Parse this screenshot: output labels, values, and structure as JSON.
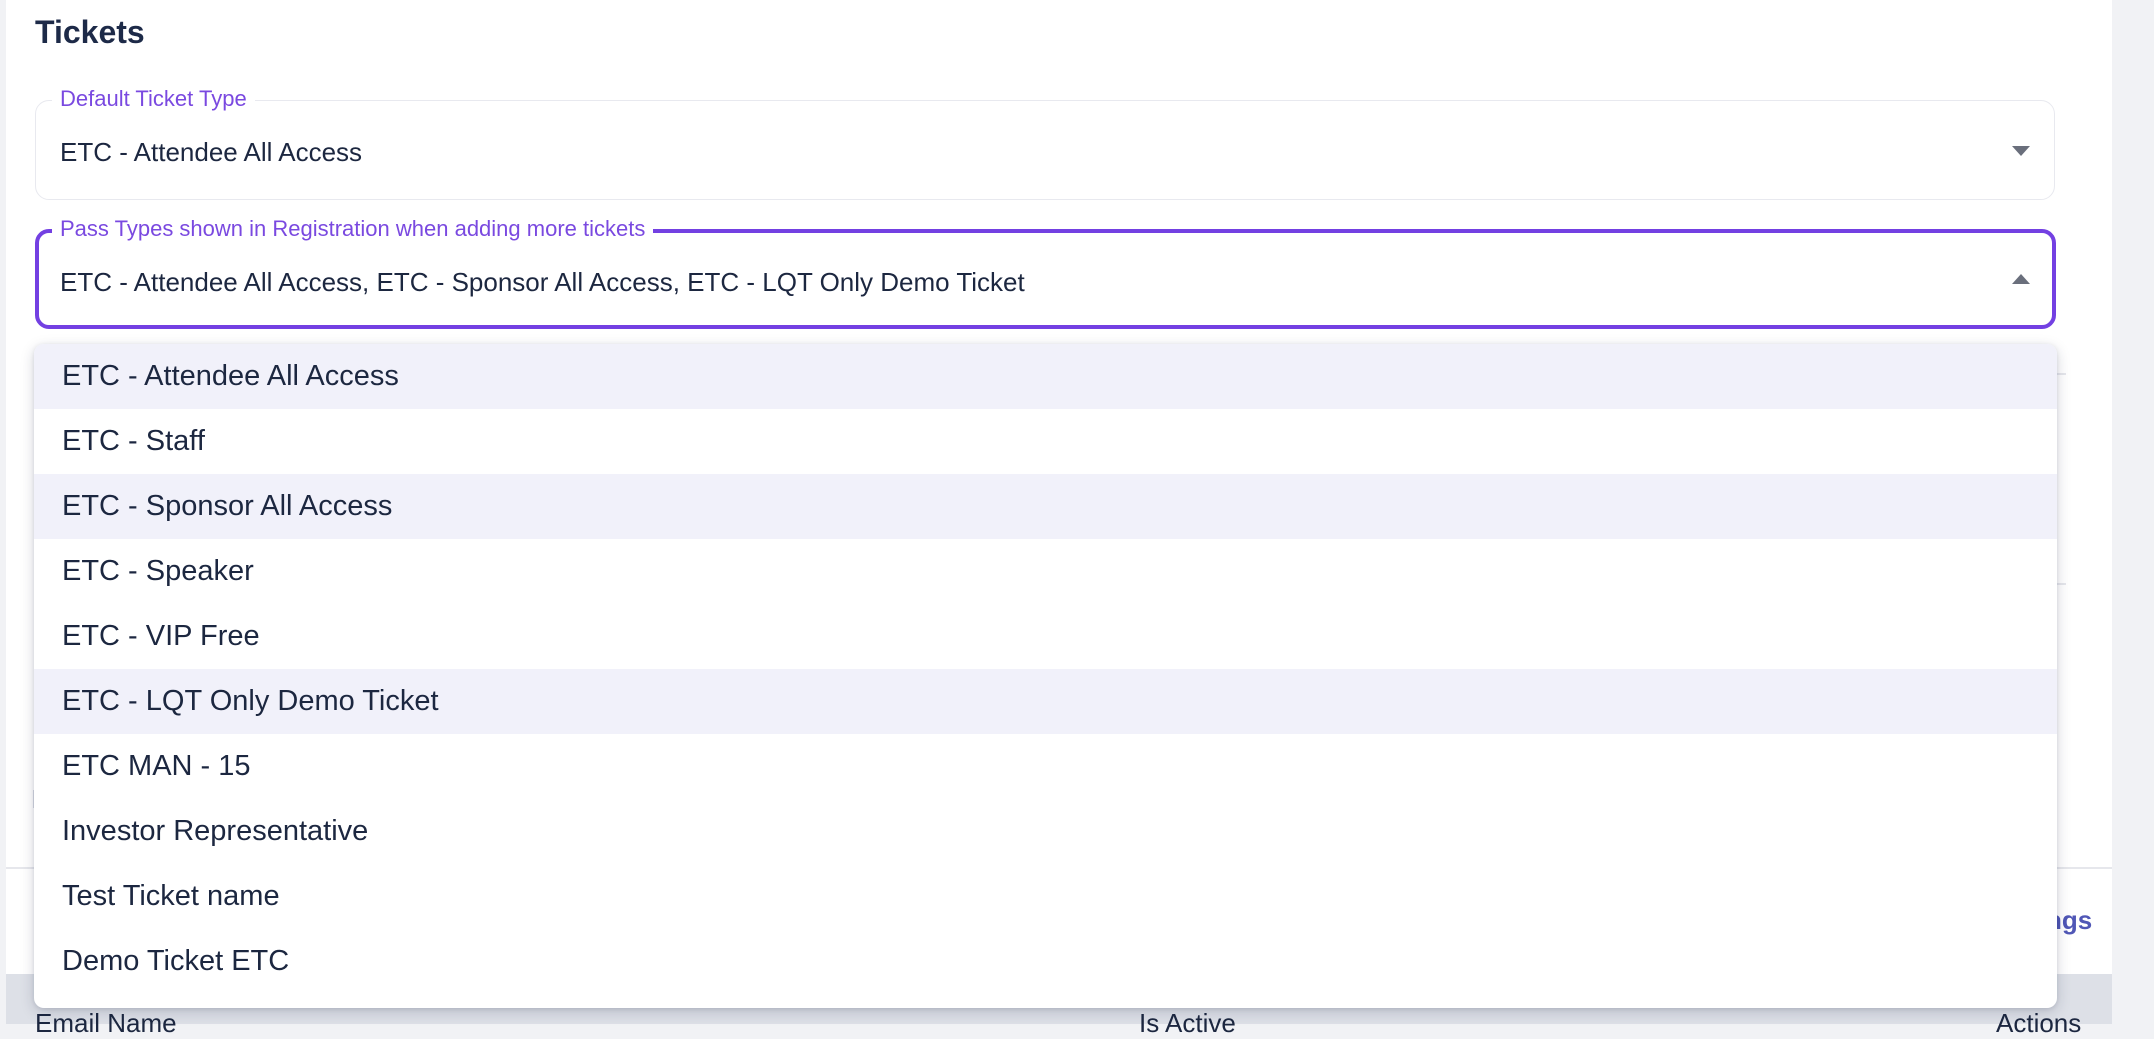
{
  "section": {
    "title": "Tickets"
  },
  "default_ticket_type": {
    "label": "Default Ticket Type",
    "value": "ETC - Attendee All Access"
  },
  "pass_types": {
    "label": "Pass Types shown in Registration when adding more tickets",
    "value": "ETC - Attendee All Access, ETC - Sponsor All Access, ETC - LQT Only Demo Ticket",
    "options": [
      {
        "label": "ETC - Attendee All Access",
        "selected": true
      },
      {
        "label": "ETC - Staff",
        "selected": false
      },
      {
        "label": "ETC - Sponsor All Access",
        "selected": true
      },
      {
        "label": "ETC - Speaker",
        "selected": false
      },
      {
        "label": "ETC - VIP Free",
        "selected": false
      },
      {
        "label": "ETC - LQT Only Demo Ticket",
        "selected": true
      },
      {
        "label": "ETC MAN - 15",
        "selected": false
      },
      {
        "label": "Investor Representative",
        "selected": false
      },
      {
        "label": "Test Ticket name",
        "selected": false
      },
      {
        "label": "Demo Ticket ETC",
        "selected": false
      }
    ]
  },
  "background": {
    "settings_link": "ngs",
    "table_headers": {
      "email_name": "Email Name",
      "is_active": "Is Active",
      "actions": "Actions"
    }
  },
  "colors": {
    "accent": "#7340e2",
    "selected_option_bg": "#f1f1fa",
    "link": "#5057b6"
  }
}
